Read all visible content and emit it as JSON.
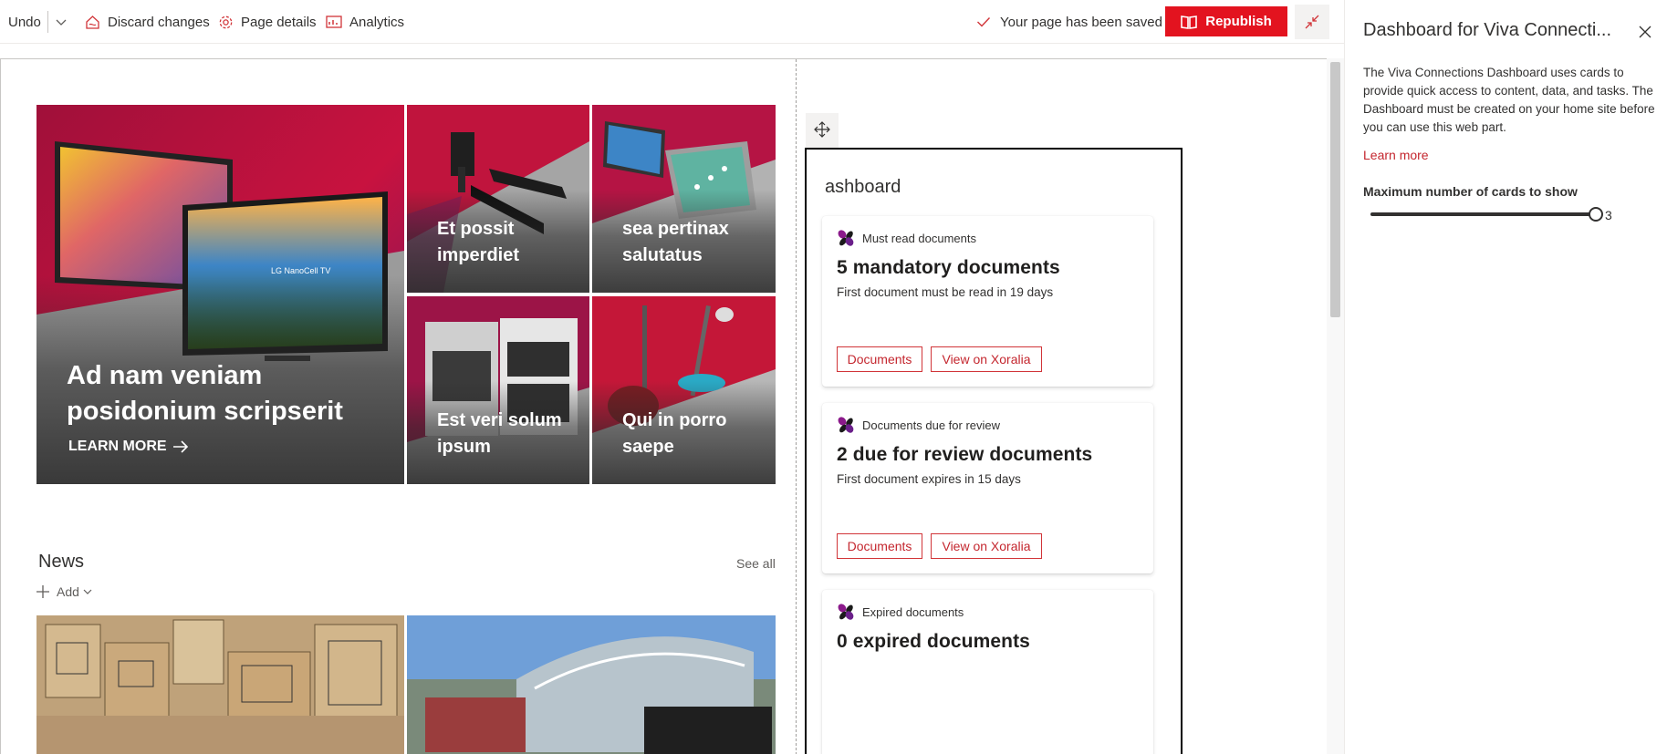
{
  "toolbar": {
    "undo_label": "Undo",
    "discard_label": "Discard changes",
    "page_details_label": "Page details",
    "analytics_label": "Analytics",
    "saved_status": "Your page has been saved",
    "republish_label": "Republish"
  },
  "hero": {
    "main": {
      "title": "Ad nam veniam posidonium scripserit",
      "cta": "LEARN MORE"
    },
    "tiles": [
      {
        "title": "Et possit imperdiet"
      },
      {
        "title": "sea pertinax salutatus"
      },
      {
        "title": "Est veri solum ipsum"
      },
      {
        "title": "Qui in porro saepe"
      }
    ],
    "tv_brand_text": "LG NanoCell TV"
  },
  "news": {
    "heading": "News",
    "see_all": "See all",
    "add_label": "Add"
  },
  "dashboard": {
    "title": "ashboard",
    "cards": [
      {
        "header": "Must read documents",
        "headline": "5 mandatory documents",
        "subtext": "First document must be read in 19 days",
        "buttons": [
          "Documents",
          "View on Xoralia"
        ]
      },
      {
        "header": "Documents due for review",
        "headline": "2 due for review documents",
        "subtext": "First document expires in 15 days",
        "buttons": [
          "Documents",
          "View on Xoralia"
        ]
      },
      {
        "header": "Expired documents",
        "headline": "0 expired documents",
        "subtext": "",
        "buttons": []
      }
    ]
  },
  "property_pane": {
    "title": "Dashboard for Viva Connecti...",
    "description": "The Viva Connections Dashboard uses cards to provide quick access to content, data, and tasks. The Dashboard must be created on your home site before you can use this web part.",
    "learn_more": "Learn more",
    "slider_label": "Maximum number of cards to show",
    "slider_value": "3",
    "slider_fraction": 1.0
  },
  "colors": {
    "accent": "#e3131f",
    "link": "#c4262e",
    "text": "#323130"
  }
}
